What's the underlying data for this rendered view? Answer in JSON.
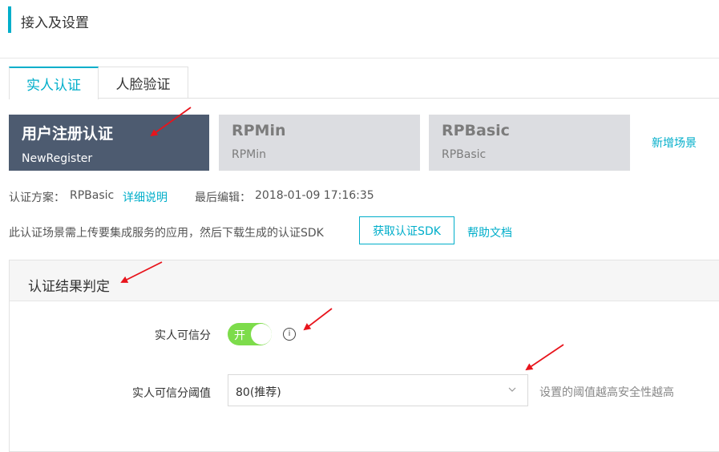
{
  "header": {
    "title": "接入及设置"
  },
  "tabs": [
    {
      "label": "实人认证",
      "active": true
    },
    {
      "label": "人脸验证",
      "active": false
    }
  ],
  "scenes": [
    {
      "title": "用户注册认证",
      "code": "NewRegister",
      "selected": true
    },
    {
      "title": "RPMin",
      "code": "RPMin",
      "selected": false
    },
    {
      "title": "RPBasic",
      "code": "RPBasic",
      "selected": false
    }
  ],
  "add_scene_label": "新增场景",
  "info": {
    "scheme_label": "认证方案：",
    "scheme_value": "RPBasic",
    "details_link": "详细说明",
    "last_edit_label": "最后编辑：",
    "last_edit_value": "2018-01-09 17:16:35"
  },
  "sdk": {
    "note": "此认证场景需上传要集成服务的应用，然后下载生成的认证SDK",
    "button_label": "获取认证SDK",
    "help_link": "帮助文档"
  },
  "result_panel": {
    "title": "认证结果判定",
    "trust_score_label": "实人可信分",
    "toggle_on_text": "开",
    "toggle_state": true,
    "info_icon_glyph": "i",
    "threshold_label": "实人可信分阈值",
    "threshold_value": "80(推荐)",
    "threshold_hint": "设置的阈值越高安全性越高"
  },
  "colors": {
    "accent": "#00aeca",
    "active_card": "#4d5b70",
    "toggle_on": "#7ddc4b",
    "annotation_arrow": "#e8141c"
  },
  "icons": [
    "info-icon",
    "chevron-down-icon",
    "annotation-arrow"
  ]
}
